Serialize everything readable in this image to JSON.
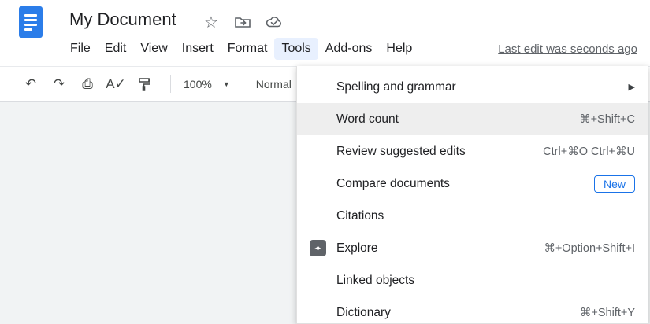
{
  "header": {
    "title": "My Document",
    "last_edit": "Last edit was seconds ago",
    "menus": [
      {
        "label": "File"
      },
      {
        "label": "Edit"
      },
      {
        "label": "View"
      },
      {
        "label": "Insert"
      },
      {
        "label": "Format"
      },
      {
        "label": "Tools",
        "active": true
      },
      {
        "label": "Add-ons"
      },
      {
        "label": "Help"
      }
    ],
    "icons": [
      "star-icon",
      "move-to-folder-icon",
      "cloud-saved-icon"
    ]
  },
  "toolbar": {
    "zoom": "100%",
    "style": "Normal",
    "icons": [
      "undo-icon",
      "redo-icon",
      "print-icon",
      "spellcheck-icon",
      "paint-format-icon"
    ]
  },
  "tools_menu": {
    "items": [
      {
        "label": "Spelling and grammar",
        "submenu": "▶"
      },
      {
        "label": "Word count",
        "shortcut": "⌘+Shift+C",
        "highlighted": true
      },
      {
        "label": "Review suggested edits",
        "shortcut": "Ctrl+⌘O Ctrl+⌘U"
      },
      {
        "label": "Compare documents",
        "badge": "New"
      },
      {
        "label": "Citations"
      },
      {
        "label": "Explore",
        "shortcut": "⌘+Option+Shift+I",
        "icon": "explore-icon",
        "icon_glyph": "✦"
      },
      {
        "label": "Linked objects"
      },
      {
        "label": "Dictionary",
        "shortcut": "⌘+Shift+Y"
      }
    ]
  },
  "glyphs": {
    "undo": "↶",
    "redo": "↷",
    "print": "⎙",
    "spellcheck": "A✓",
    "paint": "⛿",
    "caret": "▼",
    "star": "☆"
  },
  "colors": {
    "accent_blue": "#1a73e8",
    "menu_highlight": "#e8f0fe",
    "row_highlight": "#eeeeee",
    "canvas_gray": "#f1f3f4",
    "logo_blue": "#2b7de9"
  }
}
